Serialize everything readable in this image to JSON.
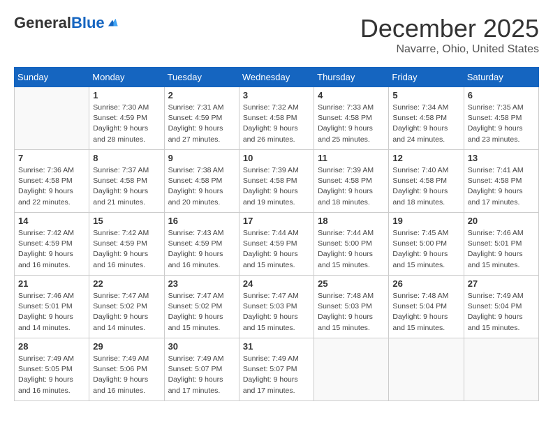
{
  "header": {
    "logo_general": "General",
    "logo_blue": "Blue",
    "month_title": "December 2025",
    "location": "Navarre, Ohio, United States"
  },
  "calendar": {
    "days_of_week": [
      "Sunday",
      "Monday",
      "Tuesday",
      "Wednesday",
      "Thursday",
      "Friday",
      "Saturday"
    ],
    "weeks": [
      [
        {
          "day": "",
          "info": ""
        },
        {
          "day": "1",
          "info": "Sunrise: 7:30 AM\nSunset: 4:59 PM\nDaylight: 9 hours\nand 28 minutes."
        },
        {
          "day": "2",
          "info": "Sunrise: 7:31 AM\nSunset: 4:59 PM\nDaylight: 9 hours\nand 27 minutes."
        },
        {
          "day": "3",
          "info": "Sunrise: 7:32 AM\nSunset: 4:58 PM\nDaylight: 9 hours\nand 26 minutes."
        },
        {
          "day": "4",
          "info": "Sunrise: 7:33 AM\nSunset: 4:58 PM\nDaylight: 9 hours\nand 25 minutes."
        },
        {
          "day": "5",
          "info": "Sunrise: 7:34 AM\nSunset: 4:58 PM\nDaylight: 9 hours\nand 24 minutes."
        },
        {
          "day": "6",
          "info": "Sunrise: 7:35 AM\nSunset: 4:58 PM\nDaylight: 9 hours\nand 23 minutes."
        }
      ],
      [
        {
          "day": "7",
          "info": "Sunrise: 7:36 AM\nSunset: 4:58 PM\nDaylight: 9 hours\nand 22 minutes."
        },
        {
          "day": "8",
          "info": "Sunrise: 7:37 AM\nSunset: 4:58 PM\nDaylight: 9 hours\nand 21 minutes."
        },
        {
          "day": "9",
          "info": "Sunrise: 7:38 AM\nSunset: 4:58 PM\nDaylight: 9 hours\nand 20 minutes."
        },
        {
          "day": "10",
          "info": "Sunrise: 7:39 AM\nSunset: 4:58 PM\nDaylight: 9 hours\nand 19 minutes."
        },
        {
          "day": "11",
          "info": "Sunrise: 7:39 AM\nSunset: 4:58 PM\nDaylight: 9 hours\nand 18 minutes."
        },
        {
          "day": "12",
          "info": "Sunrise: 7:40 AM\nSunset: 4:58 PM\nDaylight: 9 hours\nand 18 minutes."
        },
        {
          "day": "13",
          "info": "Sunrise: 7:41 AM\nSunset: 4:58 PM\nDaylight: 9 hours\nand 17 minutes."
        }
      ],
      [
        {
          "day": "14",
          "info": "Sunrise: 7:42 AM\nSunset: 4:59 PM\nDaylight: 9 hours\nand 16 minutes."
        },
        {
          "day": "15",
          "info": "Sunrise: 7:42 AM\nSunset: 4:59 PM\nDaylight: 9 hours\nand 16 minutes."
        },
        {
          "day": "16",
          "info": "Sunrise: 7:43 AM\nSunset: 4:59 PM\nDaylight: 9 hours\nand 16 minutes."
        },
        {
          "day": "17",
          "info": "Sunrise: 7:44 AM\nSunset: 4:59 PM\nDaylight: 9 hours\nand 15 minutes."
        },
        {
          "day": "18",
          "info": "Sunrise: 7:44 AM\nSunset: 5:00 PM\nDaylight: 9 hours\nand 15 minutes."
        },
        {
          "day": "19",
          "info": "Sunrise: 7:45 AM\nSunset: 5:00 PM\nDaylight: 9 hours\nand 15 minutes."
        },
        {
          "day": "20",
          "info": "Sunrise: 7:46 AM\nSunset: 5:01 PM\nDaylight: 9 hours\nand 15 minutes."
        }
      ],
      [
        {
          "day": "21",
          "info": "Sunrise: 7:46 AM\nSunset: 5:01 PM\nDaylight: 9 hours\nand 14 minutes."
        },
        {
          "day": "22",
          "info": "Sunrise: 7:47 AM\nSunset: 5:02 PM\nDaylight: 9 hours\nand 14 minutes."
        },
        {
          "day": "23",
          "info": "Sunrise: 7:47 AM\nSunset: 5:02 PM\nDaylight: 9 hours\nand 15 minutes."
        },
        {
          "day": "24",
          "info": "Sunrise: 7:47 AM\nSunset: 5:03 PM\nDaylight: 9 hours\nand 15 minutes."
        },
        {
          "day": "25",
          "info": "Sunrise: 7:48 AM\nSunset: 5:03 PM\nDaylight: 9 hours\nand 15 minutes."
        },
        {
          "day": "26",
          "info": "Sunrise: 7:48 AM\nSunset: 5:04 PM\nDaylight: 9 hours\nand 15 minutes."
        },
        {
          "day": "27",
          "info": "Sunrise: 7:49 AM\nSunset: 5:04 PM\nDaylight: 9 hours\nand 15 minutes."
        }
      ],
      [
        {
          "day": "28",
          "info": "Sunrise: 7:49 AM\nSunset: 5:05 PM\nDaylight: 9 hours\nand 16 minutes."
        },
        {
          "day": "29",
          "info": "Sunrise: 7:49 AM\nSunset: 5:06 PM\nDaylight: 9 hours\nand 16 minutes."
        },
        {
          "day": "30",
          "info": "Sunrise: 7:49 AM\nSunset: 5:07 PM\nDaylight: 9 hours\nand 17 minutes."
        },
        {
          "day": "31",
          "info": "Sunrise: 7:49 AM\nSunset: 5:07 PM\nDaylight: 9 hours\nand 17 minutes."
        },
        {
          "day": "",
          "info": ""
        },
        {
          "day": "",
          "info": ""
        },
        {
          "day": "",
          "info": ""
        }
      ]
    ]
  }
}
